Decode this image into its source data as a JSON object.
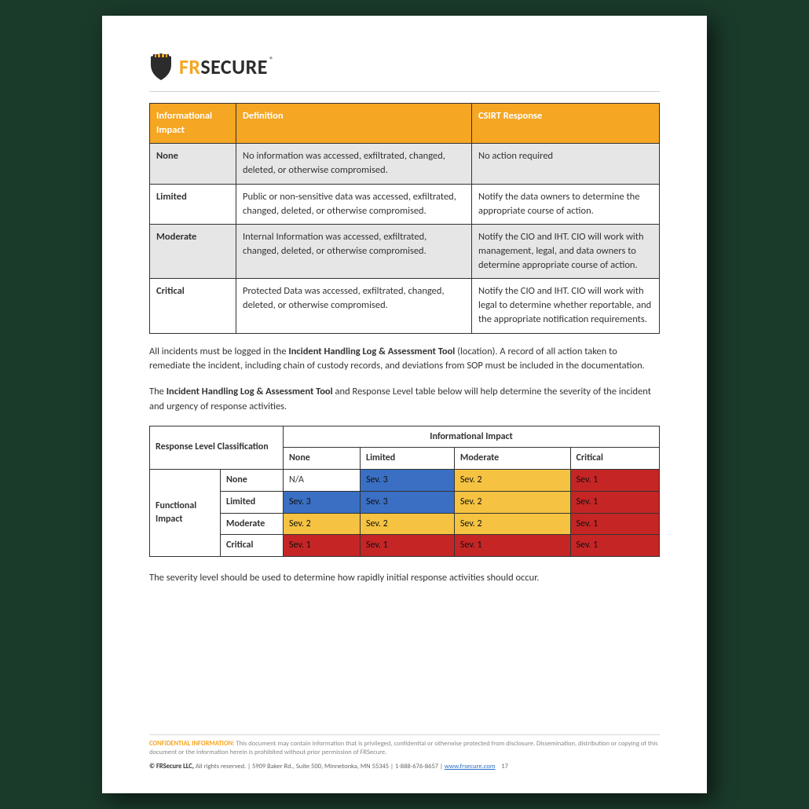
{
  "brand": {
    "fr": "FR",
    "secure": "SECURE",
    "reg": "®"
  },
  "table1": {
    "headers": {
      "impact": "Informational Impact",
      "definition": "Definition",
      "response": "CSIRT Response"
    },
    "rows": [
      {
        "level": "None",
        "definition": "No information was accessed, exfiltrated, changed, deleted, or otherwise compromised.",
        "response": "No action required",
        "shaded": true
      },
      {
        "level": "Limited",
        "definition": "Public or non-sensitive data was accessed, exfiltrated, changed, deleted, or otherwise compromised.",
        "response": "Notify the data owners to determine the appropriate course of action.",
        "shaded": false
      },
      {
        "level": "Moderate",
        "definition": "Internal Information was accessed, exfiltrated, changed, deleted, or otherwise compromised.",
        "response": "Notify the CIO and IHT. CIO will work with management, legal, and data owners to determine appropriate course of action.",
        "shaded": true
      },
      {
        "level": "Critical",
        "definition": "Protected Data was accessed, exfiltrated, changed, deleted, or otherwise compromised.",
        "response": "Notify the CIO and IHT. CIO will work with legal to determine whether reportable, and the appropriate notification requirements.",
        "shaded": false
      }
    ]
  },
  "para1": {
    "prefix": "All incidents must be logged in the ",
    "bold": "Incident Handling Log & Assessment Tool",
    "suffix": " (location).  A record of all action taken to remediate the incident, including chain of custody records, and deviations from SOP must be included in the documentation."
  },
  "para2": {
    "prefix": "The ",
    "bold": "Incident Handling Log & Assessment Tool",
    "suffix": " and Response Level table below will help determine the severity of the incident and urgency of response activities."
  },
  "matrix": {
    "corner": "Response Level Classification",
    "top_header": "Informational Impact",
    "cols": [
      "None",
      "Limited",
      "Moderate",
      "Critical"
    ],
    "row_group": "Functional Impact",
    "row_labels": [
      "None",
      "Limited",
      "Moderate",
      "Critical"
    ],
    "cells": [
      [
        {
          "t": "N/A",
          "c": "na"
        },
        {
          "t": "Sev. 3",
          "c": "sev3"
        },
        {
          "t": "Sev. 2",
          "c": "sev2"
        },
        {
          "t": "Sev. 1",
          "c": "sev1"
        }
      ],
      [
        {
          "t": "Sev. 3",
          "c": "sev3"
        },
        {
          "t": "Sev. 3",
          "c": "sev3"
        },
        {
          "t": "Sev. 2",
          "c": "sev2"
        },
        {
          "t": "Sev. 1",
          "c": "sev1"
        }
      ],
      [
        {
          "t": "Sev. 2",
          "c": "sev2"
        },
        {
          "t": "Sev. 2",
          "c": "sev2"
        },
        {
          "t": "Sev. 2",
          "c": "sev2"
        },
        {
          "t": "Sev. 1",
          "c": "sev1"
        }
      ],
      [
        {
          "t": "Sev. 1",
          "c": "sev1"
        },
        {
          "t": "Sev. 1",
          "c": "sev1"
        },
        {
          "t": "Sev. 1",
          "c": "sev1"
        },
        {
          "t": "Sev. 1",
          "c": "sev1"
        }
      ]
    ]
  },
  "para3": "The severity level should be used to determine how rapidly initial response activities should occur.",
  "footer": {
    "conf_label": "CONFIDENTIAL INFORMATION:",
    "conf_text": " This document may contain information that is privileged, confidential or otherwise protected from disclosure. Dissemination, distribution or copying of this document or the information herein is prohibited without prior permission of FRSecure.",
    "company_bold": "© FRSecure LLC,",
    "company_rest": " All rights reserved. | 5909 Baker Rd., Suite 500, Minnetonka, MN 55345 | 1-888-676-8657 | ",
    "link": "www.frsecure.com",
    "page": "17"
  }
}
